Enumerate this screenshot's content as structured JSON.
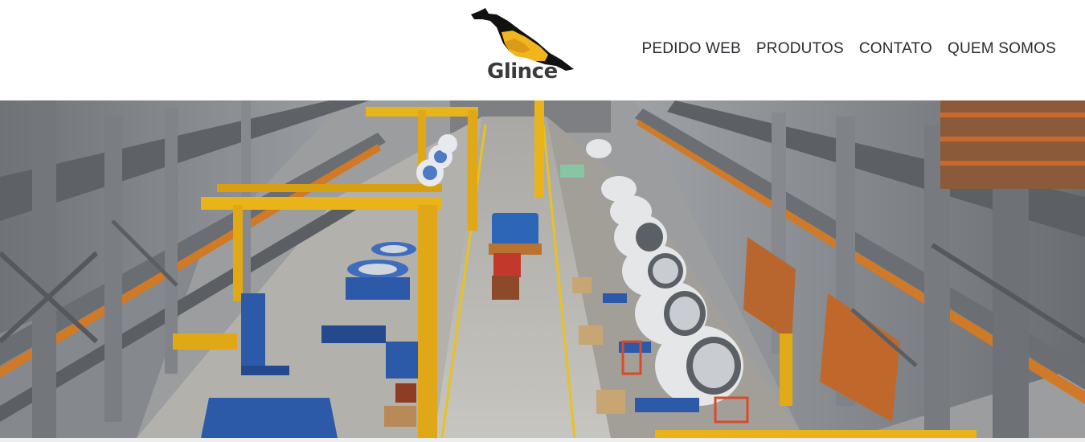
{
  "header": {
    "logo": {
      "text": "Glince",
      "icon": "panther-silhouette-logo",
      "colors": {
        "black": "#111111",
        "yellow": "#f2b51d",
        "text": "#3a3a3a"
      }
    },
    "nav": {
      "items": [
        {
          "label": "PEDIDO WEB"
        },
        {
          "label": "PRODUTOS"
        },
        {
          "label": "CONTATO"
        },
        {
          "label": "QUEM SOMOS"
        }
      ],
      "color": "#2b2b33"
    }
  },
  "hero": {
    "image": "factory-floor-photo",
    "colors": {
      "crane_yellow": "#e9b31a",
      "steel_gray": "#8a8e94",
      "machine_blue": "#2d5aa8",
      "floor": "#c4c2bd"
    }
  }
}
